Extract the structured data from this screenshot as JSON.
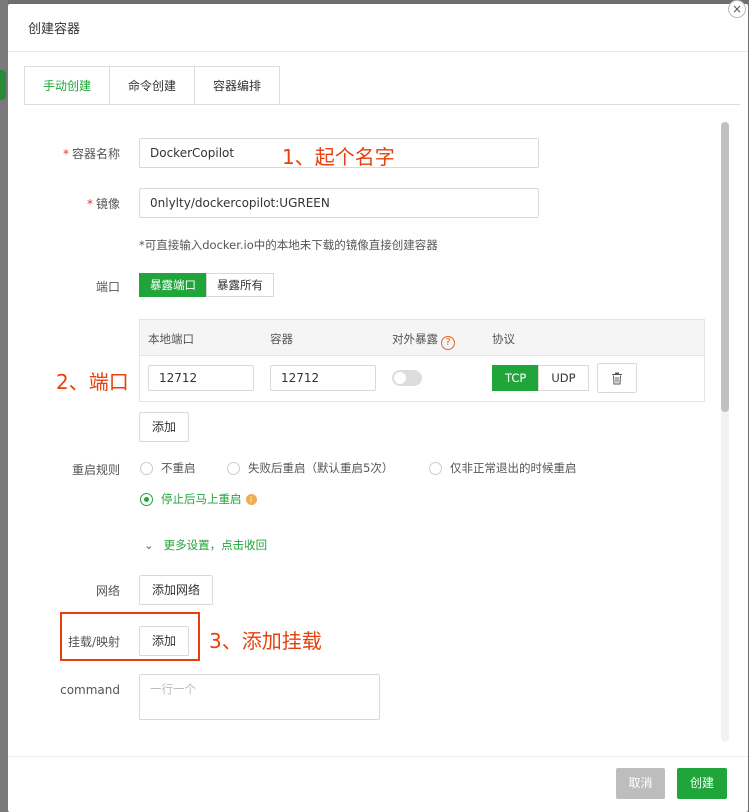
{
  "dialog": {
    "title": "创建容器",
    "close_glyph": "×"
  },
  "tabs": [
    {
      "label": "手动创建",
      "active": true
    },
    {
      "label": "命令创建",
      "active": false
    },
    {
      "label": "容器编排",
      "active": false
    }
  ],
  "form": {
    "name": {
      "label": "容器名称",
      "required": "*",
      "value": "DockerCopilot"
    },
    "image": {
      "label": "镜像",
      "required": "*",
      "value": "0nlylty/dockercopilot:UGREEN"
    },
    "image_hint": "*可直接输入docker.io中的本地未下载的镜像直接创建容器",
    "port": {
      "label": "端口",
      "modes": [
        "暴露端口",
        "暴露所有"
      ],
      "selected_mode": "暴露端口",
      "columns": [
        "本地端口",
        "容器",
        "对外暴露",
        "协议"
      ],
      "help_glyph": "?",
      "row": {
        "local": "12712",
        "container": "12712",
        "expose": false,
        "protocols": [
          "TCP",
          "UDP"
        ],
        "selected_protocol": "TCP",
        "delete_icon": "trash-icon"
      },
      "add_label": "添加"
    },
    "restart": {
      "label": "重启规则",
      "options": [
        "不重启",
        "失败后重启（默认重启5次）",
        "仅非正常退出的时候重启",
        "停止后马上重启"
      ],
      "selected": "停止后马上重启",
      "info_glyph": "i"
    },
    "more_settings": "更多设置，点击收回",
    "network": {
      "label": "网络",
      "button": "添加网络"
    },
    "mount": {
      "label": "挂载/映射",
      "button": "添加"
    },
    "command": {
      "label": "command",
      "placeholder": "一行一个"
    }
  },
  "footer": {
    "cancel": "取消",
    "create": "创建"
  },
  "annotations": {
    "a1": "1、起个名字",
    "a2": "2、端口",
    "a3": "3、添加挂载"
  },
  "colors": {
    "accent": "#20a53a",
    "annotation": "#e8400c",
    "required": "#e53935"
  }
}
